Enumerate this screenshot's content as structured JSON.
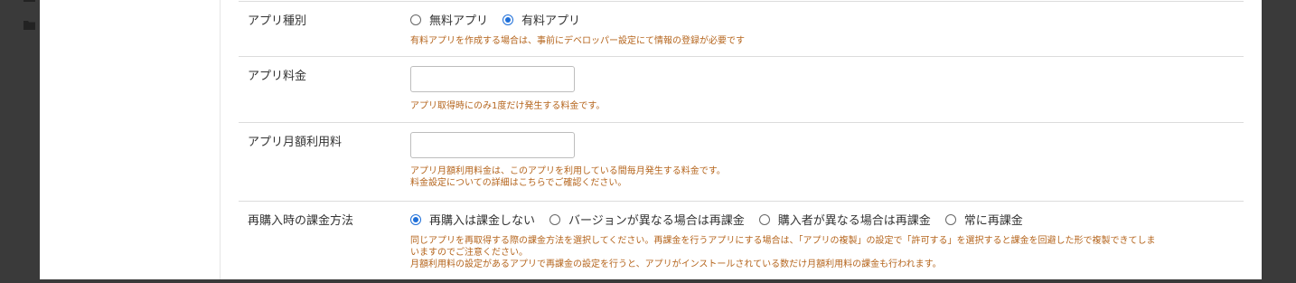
{
  "form": {
    "app_type": {
      "label": "アプリ種別",
      "options": [
        {
          "label": "無料アプリ",
          "checked": false
        },
        {
          "label": "有料アプリ",
          "checked": true
        }
      ],
      "help": "有料アプリを作成する場合は、事前にデベロッパー設定にて情報の登録が必要です"
    },
    "app_price": {
      "label": "アプリ料金",
      "value": "",
      "help": "アプリ取得時にのみ1度だけ発生する料金です。"
    },
    "monthly_fee": {
      "label": "アプリ月額利用料",
      "value": "",
      "help_line1": "アプリ月額利用料金は、このアプリを利用している間毎月発生する料金です。",
      "help_line2": "料金設定についての詳細はこちらでご確認ください。"
    },
    "repurchase": {
      "label": "再購入時の課金方法",
      "options": [
        {
          "label": "再購入は課金しない",
          "checked": true
        },
        {
          "label": "バージョンが異なる場合は再課金",
          "checked": false
        },
        {
          "label": "購入者が異なる場合は再課金",
          "checked": false
        },
        {
          "label": "常に再課金",
          "checked": false
        }
      ],
      "help_line1": "同じアプリを再取得する際の課金方法を選択してください。再課金を行うアプリにする場合は、「アプリの複製」の設定で「許可する」を選択すると課金を回避した形で複製できてしま",
      "help_line2": "いますのでご注意ください。",
      "help_line3": "月額利用料の設定があるアプリで再課金の設定を行うと、アプリがインストールされている数だけ月額利用料の課金も行われます。"
    }
  },
  "colors": {
    "help_text": "#b5651d",
    "radio_accent": "#1e6fd9",
    "frame": "#3a3a3a"
  },
  "icons": [
    "folder-icon"
  ]
}
